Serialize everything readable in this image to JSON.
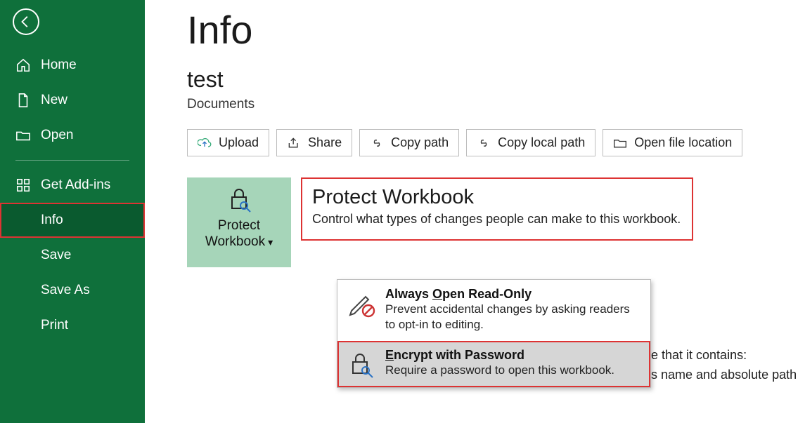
{
  "sidebar": {
    "items": [
      {
        "label": "Home"
      },
      {
        "label": "New"
      },
      {
        "label": "Open"
      },
      {
        "label": "Get Add-ins"
      },
      {
        "label": "Info"
      },
      {
        "label": "Save"
      },
      {
        "label": "Save As"
      },
      {
        "label": "Print"
      }
    ]
  },
  "page": {
    "title": "Info",
    "doc_name": "test",
    "doc_location": "Documents"
  },
  "actions": {
    "upload": "Upload",
    "share": "Share",
    "copy_path": "Copy path",
    "copy_local_path": "Copy local path",
    "open_location": "Open file location"
  },
  "protect": {
    "tile_line1": "Protect",
    "tile_line2": "Workbook",
    "heading": "Protect Workbook",
    "desc": "Control what types of changes people can make to this workbook."
  },
  "dropdown": {
    "item0": {
      "title_pre": "Always ",
      "title_accel": "O",
      "title_post": "pen Read-Only",
      "desc": "Prevent accidental changes by asking readers to opt-in to editing."
    },
    "item1": {
      "title_accel": "E",
      "title_post": "ncrypt with Password",
      "desc": "Require a password to open this workbook."
    }
  },
  "bg": {
    "line1": "e that it contains:",
    "line2": "s name and absolute path"
  }
}
